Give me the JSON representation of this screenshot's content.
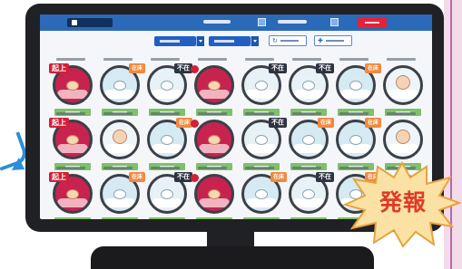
{
  "app": {
    "colors": {
      "header": "#2b6ab8",
      "accent_red": "#e2233a",
      "select_blue": "#2160c2",
      "tag_green": "#7fc06a",
      "alert_red": "#d12038",
      "normal_orange": "#f2893c",
      "absent_dark": "#2d3340"
    }
  },
  "toolbar": {
    "buttons": [
      {
        "icon": "refresh-icon"
      },
      {
        "icon": "plus-icon"
      }
    ]
  },
  "grid": {
    "rows": [
      {
        "cells": [
          {
            "status": "alert",
            "badge": "起上"
          },
          {
            "status": "normal",
            "badge": "在床"
          },
          {
            "status": "absent",
            "badge": "不在"
          },
          {
            "status": "alert",
            "badge": ""
          },
          {
            "status": "absent",
            "badge": "不在"
          },
          {
            "status": "absent",
            "badge": "不在"
          },
          {
            "status": "normal",
            "badge": "在床"
          },
          {
            "status": "baby",
            "badge": ""
          }
        ]
      },
      {
        "cells": [
          {
            "status": "alert",
            "badge": "起上"
          },
          {
            "status": "baby",
            "badge": ""
          },
          {
            "status": "normal",
            "badge": "在床"
          },
          {
            "status": "alert",
            "badge": ""
          },
          {
            "status": "absent",
            "badge": "不在"
          },
          {
            "status": "normal",
            "badge": "在床"
          },
          {
            "status": "normal",
            "badge": "在床"
          },
          {
            "status": "baby",
            "badge": ""
          }
        ]
      },
      {
        "cells": [
          {
            "status": "alert",
            "badge": "起上"
          },
          {
            "status": "normal",
            "badge": "在床"
          },
          {
            "status": "absent",
            "badge": "不在"
          },
          {
            "status": "alert",
            "badge": ""
          },
          {
            "status": "normal",
            "badge": "在床"
          },
          {
            "status": "absent",
            "badge": "不在"
          },
          {
            "status": "normal",
            "badge": "在床"
          },
          {
            "status": "baby",
            "badge": ""
          }
        ]
      }
    ]
  },
  "callout": {
    "text": "発報",
    "color": "#e03a2a",
    "fill": "#fbe2a4"
  }
}
